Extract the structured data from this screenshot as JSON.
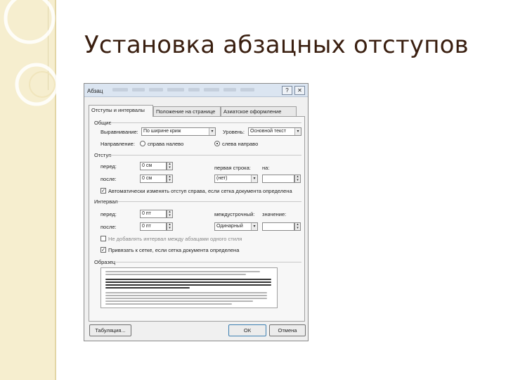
{
  "slide": {
    "title": "Установка абзацных отступов"
  },
  "dialog": {
    "title": "Абзац",
    "help_glyph": "?",
    "close_glyph": "✕",
    "tabs": [
      {
        "label": "Отступы и интервалы",
        "active": true
      },
      {
        "label": "Положение на странице",
        "active": false
      },
      {
        "label": "Азиатское оформление",
        "active": false
      }
    ],
    "general": {
      "heading": "Общие",
      "alignment_label": "Выравнивание:",
      "alignment_value": "По ширине криж",
      "level_label": "Уровень:",
      "level_value": "Основной текст",
      "direction_label": "Направление:",
      "rtl_label": "справа налево",
      "ltr_label": "слева направо",
      "selected_direction": "ltr"
    },
    "indent": {
      "heading": "Отступ",
      "before_label": "перед:",
      "before_value": "0 см",
      "after_label": "после:",
      "after_value": "0 см",
      "first_line_label": "первая строка:",
      "first_line_value": "(нет)",
      "on_label": "на:",
      "on_value": "",
      "auto_label": "Автоматически изменять отступ справа, если сетка документа определена",
      "auto_checked": true
    },
    "spacing": {
      "heading": "Интервал",
      "before_label": "перед:",
      "before_value": "0 пт",
      "after_label": "после:",
      "after_value": "0 пт",
      "line_label": "междустрочный:",
      "line_value": "Одинарный",
      "value_label": "значение:",
      "value_value": "",
      "no_space_label": "Не добавлять интервал между абзацами одного стиля",
      "no_space_checked": false,
      "grid_label": "Привязать к сетке, если сетка документа определена",
      "grid_checked": true
    },
    "sample": {
      "heading": "Образец"
    },
    "buttons": {
      "tabs_label": "Табуляция...",
      "ok_label": "ОК",
      "cancel_label": "Отмена"
    },
    "arrow_glyph": "▾",
    "spin_up_glyph": "▴",
    "spin_down_glyph": "▾",
    "check_glyph": "✓"
  },
  "colors": {
    "title_text": "#3a1f10",
    "strip": "#f6eecf",
    "dialog_titlebar": "#dbe5f1"
  }
}
